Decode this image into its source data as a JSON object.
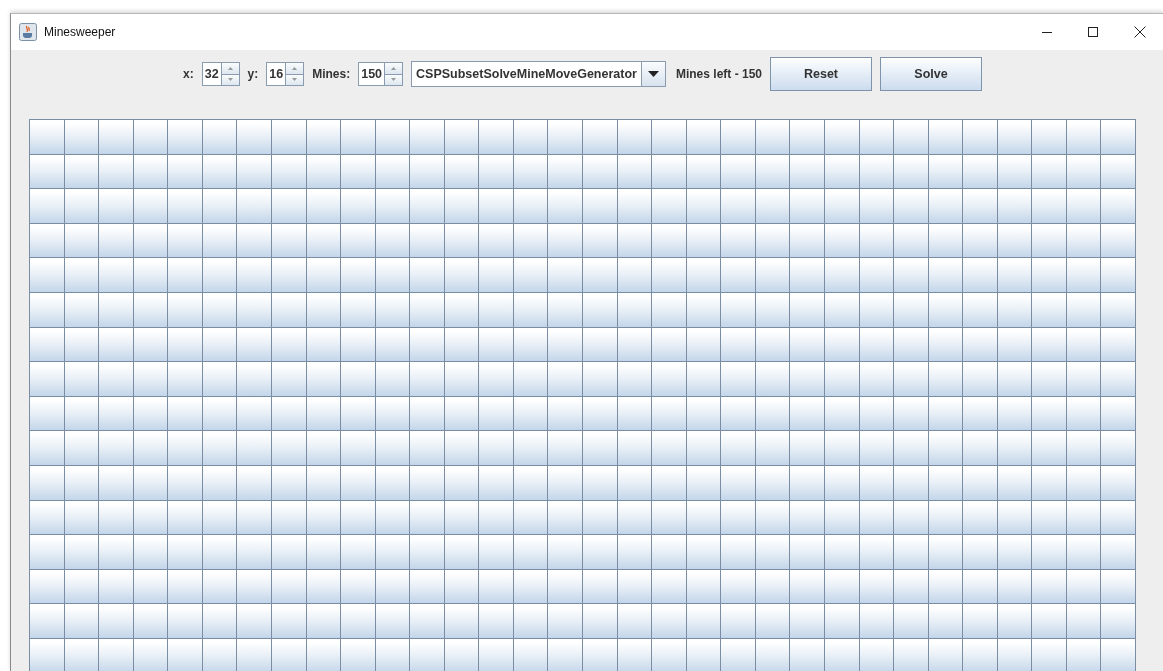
{
  "window": {
    "title": "Minesweeper"
  },
  "toolbar": {
    "fields": [
      {
        "label": "x:",
        "value": "32"
      },
      {
        "label": "y:",
        "value": "16"
      },
      {
        "label": "Mines:",
        "value": "150"
      }
    ],
    "generator": {
      "value": "CSPSubsetSolveMineMoveGenerator"
    },
    "status": "Mines left - 150",
    "buttons": [
      "Reset",
      "Solve"
    ]
  },
  "board": {
    "rows": [
      {
        "cells": [
          {
            "revealed": false
          },
          {
            "revealed": false
          },
          {
            "revealed": false
          },
          {
            "revealed": false
          },
          {
            "revealed": false
          },
          {
            "revealed": false
          },
          {
            "revealed": false
          },
          {
            "revealed": false
          },
          {
            "revealed": false
          },
          {
            "revealed": false
          },
          {
            "revealed": false
          },
          {
            "revealed": false
          },
          {
            "revealed": false
          },
          {
            "revealed": false
          },
          {
            "revealed": false
          },
          {
            "revealed": false
          },
          {
            "revealed": false
          },
          {
            "revealed": false
          },
          {
            "revealed": false
          },
          {
            "revealed": false
          },
          {
            "revealed": false
          },
          {
            "revealed": false
          },
          {
            "revealed": false
          },
          {
            "revealed": false
          },
          {
            "revealed": false
          },
          {
            "revealed": false
          },
          {
            "revealed": false
          },
          {
            "revealed": false
          },
          {
            "revealed": false
          },
          {
            "revealed": false
          },
          {
            "revealed": false
          },
          {
            "revealed": false
          }
        ]
      },
      {
        "cells": [
          {
            "revealed": false
          },
          {
            "revealed": false
          },
          {
            "revealed": false
          },
          {
            "revealed": false
          },
          {
            "revealed": false
          },
          {
            "revealed": false
          },
          {
            "revealed": false
          },
          {
            "revealed": false
          },
          {
            "revealed": false
          },
          {
            "revealed": false
          },
          {
            "revealed": false
          },
          {
            "revealed": false
          },
          {
            "revealed": false
          },
          {
            "revealed": false
          },
          {
            "revealed": false
          },
          {
            "revealed": false
          },
          {
            "revealed": false
          },
          {
            "revealed": false
          },
          {
            "revealed": false
          },
          {
            "revealed": false
          },
          {
            "revealed": false
          },
          {
            "revealed": false
          },
          {
            "revealed": false
          },
          {
            "revealed": false
          },
          {
            "revealed": false
          },
          {
            "revealed": false
          },
          {
            "revealed": false
          },
          {
            "revealed": false
          },
          {
            "revealed": false
          },
          {
            "revealed": false
          },
          {
            "revealed": false
          },
          {
            "revealed": false
          }
        ]
      },
      {
        "cells": [
          {
            "revealed": false
          },
          {
            "revealed": false
          },
          {
            "revealed": false
          },
          {
            "revealed": false
          },
          {
            "revealed": false
          },
          {
            "revealed": false
          },
          {
            "revealed": false
          },
          {
            "revealed": false
          },
          {
            "revealed": false
          },
          {
            "revealed": false
          },
          {
            "revealed": false
          },
          {
            "revealed": false
          },
          {
            "revealed": false
          },
          {
            "revealed": false
          },
          {
            "revealed": false
          },
          {
            "revealed": false
          },
          {
            "revealed": false
          },
          {
            "revealed": false
          },
          {
            "revealed": false
          },
          {
            "revealed": false
          },
          {
            "revealed": false
          },
          {
            "revealed": false
          },
          {
            "revealed": false
          },
          {
            "revealed": false
          },
          {
            "revealed": false
          },
          {
            "revealed": false
          },
          {
            "revealed": false
          },
          {
            "revealed": false
          },
          {
            "revealed": false
          },
          {
            "revealed": false
          },
          {
            "revealed": false
          },
          {
            "revealed": false
          }
        ]
      },
      {
        "cells": [
          {
            "revealed": false
          },
          {
            "revealed": false
          },
          {
            "revealed": false
          },
          {
            "revealed": false
          },
          {
            "revealed": false
          },
          {
            "revealed": false
          },
          {
            "revealed": false
          },
          {
            "revealed": false
          },
          {
            "revealed": false
          },
          {
            "revealed": false
          },
          {
            "revealed": false
          },
          {
            "revealed": false
          },
          {
            "revealed": false
          },
          {
            "revealed": false
          },
          {
            "revealed": false
          },
          {
            "revealed": false
          },
          {
            "revealed": false
          },
          {
            "revealed": false
          },
          {
            "revealed": false
          },
          {
            "revealed": false
          },
          {
            "revealed": false
          },
          {
            "revealed": false
          },
          {
            "revealed": false
          },
          {
            "revealed": false
          },
          {
            "revealed": false
          },
          {
            "revealed": false
          },
          {
            "revealed": false
          },
          {
            "revealed": false
          },
          {
            "revealed": false
          },
          {
            "revealed": false
          },
          {
            "revealed": false
          },
          {
            "revealed": false
          }
        ]
      },
      {
        "cells": [
          {
            "revealed": false
          },
          {
            "revealed": false
          },
          {
            "revealed": false
          },
          {
            "revealed": false
          },
          {
            "revealed": false
          },
          {
            "revealed": false
          },
          {
            "revealed": false
          },
          {
            "revealed": false
          },
          {
            "revealed": false
          },
          {
            "revealed": false
          },
          {
            "revealed": false
          },
          {
            "revealed": false
          },
          {
            "revealed": false
          },
          {
            "revealed": false
          },
          {
            "revealed": false
          },
          {
            "revealed": false
          },
          {
            "revealed": false
          },
          {
            "revealed": false
          },
          {
            "revealed": false
          },
          {
            "revealed": false
          },
          {
            "revealed": false
          },
          {
            "revealed": false
          },
          {
            "revealed": false
          },
          {
            "revealed": false
          },
          {
            "revealed": false
          },
          {
            "revealed": false
          },
          {
            "revealed": false
          },
          {
            "revealed": false
          },
          {
            "revealed": false
          },
          {
            "revealed": false
          },
          {
            "revealed": false
          },
          {
            "revealed": false
          }
        ]
      },
      {
        "cells": [
          {
            "revealed": false
          },
          {
            "revealed": false
          },
          {
            "revealed": false
          },
          {
            "revealed": false
          },
          {
            "revealed": false
          },
          {
            "revealed": false
          },
          {
            "revealed": false
          },
          {
            "revealed": false
          },
          {
            "revealed": false
          },
          {
            "revealed": false
          },
          {
            "revealed": false
          },
          {
            "revealed": false
          },
          {
            "revealed": false
          },
          {
            "revealed": false
          },
          {
            "revealed": false
          },
          {
            "revealed": false
          },
          {
            "revealed": false
          },
          {
            "revealed": false
          },
          {
            "revealed": false
          },
          {
            "revealed": false
          },
          {
            "revealed": false
          },
          {
            "revealed": false
          },
          {
            "revealed": false
          },
          {
            "revealed": false
          },
          {
            "revealed": false
          },
          {
            "revealed": false
          },
          {
            "revealed": false
          },
          {
            "revealed": false
          },
          {
            "revealed": false
          },
          {
            "revealed": false
          },
          {
            "revealed": false
          },
          {
            "revealed": false
          }
        ]
      },
      {
        "cells": [
          {
            "revealed": false
          },
          {
            "revealed": false
          },
          {
            "revealed": false
          },
          {
            "revealed": false
          },
          {
            "revealed": false
          },
          {
            "revealed": false
          },
          {
            "revealed": false
          },
          {
            "revealed": false
          },
          {
            "revealed": false
          },
          {
            "revealed": false
          },
          {
            "revealed": false
          },
          {
            "revealed": false
          },
          {
            "revealed": false
          },
          {
            "revealed": false
          },
          {
            "revealed": false
          },
          {
            "revealed": false
          },
          {
            "revealed": false
          },
          {
            "revealed": false
          },
          {
            "revealed": false
          },
          {
            "revealed": false
          },
          {
            "revealed": false
          },
          {
            "revealed": false
          },
          {
            "revealed": false
          },
          {
            "revealed": false
          },
          {
            "revealed": false
          },
          {
            "revealed": false
          },
          {
            "revealed": false
          },
          {
            "revealed": false
          },
          {
            "revealed": false
          },
          {
            "revealed": false
          },
          {
            "revealed": false
          },
          {
            "revealed": false
          }
        ]
      },
      {
        "cells": [
          {
            "revealed": false
          },
          {
            "revealed": false
          },
          {
            "revealed": false
          },
          {
            "revealed": false
          },
          {
            "revealed": false
          },
          {
            "revealed": false
          },
          {
            "revealed": false
          },
          {
            "revealed": false
          },
          {
            "revealed": false
          },
          {
            "revealed": false
          },
          {
            "revealed": false
          },
          {
            "revealed": false
          },
          {
            "revealed": false
          },
          {
            "revealed": false
          },
          {
            "revealed": false
          },
          {
            "revealed": false
          },
          {
            "revealed": false
          },
          {
            "revealed": false
          },
          {
            "revealed": false
          },
          {
            "revealed": false
          },
          {
            "revealed": false
          },
          {
            "revealed": false
          },
          {
            "revealed": false
          },
          {
            "revealed": false
          },
          {
            "revealed": false
          },
          {
            "revealed": false
          },
          {
            "revealed": false
          },
          {
            "revealed": false
          },
          {
            "revealed": false
          },
          {
            "revealed": false
          },
          {
            "revealed": false
          },
          {
            "revealed": false
          }
        ]
      },
      {
        "cells": [
          {
            "revealed": false
          },
          {
            "revealed": false
          },
          {
            "revealed": false
          },
          {
            "revealed": false
          },
          {
            "revealed": false
          },
          {
            "revealed": false
          },
          {
            "revealed": false
          },
          {
            "revealed": false
          },
          {
            "revealed": false
          },
          {
            "revealed": false
          },
          {
            "revealed": false
          },
          {
            "revealed": false
          },
          {
            "revealed": false
          },
          {
            "revealed": false
          },
          {
            "revealed": false
          },
          {
            "revealed": false
          },
          {
            "revealed": false
          },
          {
            "revealed": false
          },
          {
            "revealed": false
          },
          {
            "revealed": false
          },
          {
            "revealed": false
          },
          {
            "revealed": false
          },
          {
            "revealed": false
          },
          {
            "revealed": false
          },
          {
            "revealed": false
          },
          {
            "revealed": false
          },
          {
            "revealed": false
          },
          {
            "revealed": false
          },
          {
            "revealed": false
          },
          {
            "revealed": false
          },
          {
            "revealed": false
          },
          {
            "revealed": false
          }
        ]
      },
      {
        "cells": [
          {
            "revealed": false
          },
          {
            "revealed": false
          },
          {
            "revealed": false
          },
          {
            "revealed": false
          },
          {
            "revealed": false
          },
          {
            "revealed": false
          },
          {
            "revealed": false
          },
          {
            "revealed": false
          },
          {
            "revealed": false
          },
          {
            "revealed": false
          },
          {
            "revealed": false
          },
          {
            "revealed": false
          },
          {
            "revealed": false
          },
          {
            "revealed": false
          },
          {
            "revealed": false
          },
          {
            "revealed": false
          },
          {
            "revealed": false
          },
          {
            "revealed": false
          },
          {
            "revealed": false
          },
          {
            "revealed": false
          },
          {
            "revealed": false
          },
          {
            "revealed": false
          },
          {
            "revealed": false
          },
          {
            "revealed": false
          },
          {
            "revealed": false
          },
          {
            "revealed": false
          },
          {
            "revealed": false
          },
          {
            "revealed": false
          },
          {
            "revealed": false
          },
          {
            "revealed": false
          },
          {
            "revealed": false
          },
          {
            "revealed": false
          }
        ]
      },
      {
        "cells": [
          {
            "revealed": false
          },
          {
            "revealed": false
          },
          {
            "revealed": false
          },
          {
            "revealed": false
          },
          {
            "revealed": false
          },
          {
            "revealed": false
          },
          {
            "revealed": false
          },
          {
            "revealed": false
          },
          {
            "revealed": false
          },
          {
            "revealed": false
          },
          {
            "revealed": false
          },
          {
            "revealed": false
          },
          {
            "revealed": false
          },
          {
            "revealed": false
          },
          {
            "revealed": false
          },
          {
            "revealed": false
          },
          {
            "revealed": false
          },
          {
            "revealed": false
          },
          {
            "revealed": false
          },
          {
            "revealed": false
          },
          {
            "revealed": false
          },
          {
            "revealed": false
          },
          {
            "revealed": false
          },
          {
            "revealed": false
          },
          {
            "revealed": false
          },
          {
            "revealed": false
          },
          {
            "revealed": false
          },
          {
            "revealed": false
          },
          {
            "revealed": false
          },
          {
            "revealed": false
          },
          {
            "revealed": false
          },
          {
            "revealed": false
          }
        ]
      },
      {
        "cells": [
          {
            "revealed": false
          },
          {
            "revealed": false
          },
          {
            "revealed": false
          },
          {
            "revealed": false
          },
          {
            "revealed": false
          },
          {
            "revealed": false
          },
          {
            "revealed": false
          },
          {
            "revealed": false
          },
          {
            "revealed": false
          },
          {
            "revealed": false
          },
          {
            "revealed": false
          },
          {
            "revealed": false
          },
          {
            "revealed": false
          },
          {
            "revealed": false
          },
          {
            "revealed": false
          },
          {
            "revealed": false
          },
          {
            "revealed": false
          },
          {
            "revealed": false
          },
          {
            "revealed": false
          },
          {
            "revealed": false
          },
          {
            "revealed": false
          },
          {
            "revealed": false
          },
          {
            "revealed": false
          },
          {
            "revealed": false
          },
          {
            "revealed": false
          },
          {
            "revealed": false
          },
          {
            "revealed": false
          },
          {
            "revealed": false
          },
          {
            "revealed": false
          },
          {
            "revealed": false
          },
          {
            "revealed": false
          },
          {
            "revealed": false
          }
        ]
      },
      {
        "cells": [
          {
            "revealed": false
          },
          {
            "revealed": false
          },
          {
            "revealed": false
          },
          {
            "revealed": false
          },
          {
            "revealed": false
          },
          {
            "revealed": false
          },
          {
            "revealed": false
          },
          {
            "revealed": false
          },
          {
            "revealed": false
          },
          {
            "revealed": false
          },
          {
            "revealed": false
          },
          {
            "revealed": false
          },
          {
            "revealed": false
          },
          {
            "revealed": false
          },
          {
            "revealed": false
          },
          {
            "revealed": false
          },
          {
            "revealed": false
          },
          {
            "revealed": false
          },
          {
            "revealed": false
          },
          {
            "revealed": false
          },
          {
            "revealed": false
          },
          {
            "revealed": false
          },
          {
            "revealed": false
          },
          {
            "revealed": false
          },
          {
            "revealed": false
          },
          {
            "revealed": false
          },
          {
            "revealed": false
          },
          {
            "revealed": false
          },
          {
            "revealed": false
          },
          {
            "revealed": false
          },
          {
            "revealed": false
          },
          {
            "revealed": false
          }
        ]
      },
      {
        "cells": [
          {
            "revealed": false
          },
          {
            "revealed": false
          },
          {
            "revealed": false
          },
          {
            "revealed": false
          },
          {
            "revealed": false
          },
          {
            "revealed": false
          },
          {
            "revealed": false
          },
          {
            "revealed": false
          },
          {
            "revealed": false
          },
          {
            "revealed": false
          },
          {
            "revealed": false
          },
          {
            "revealed": false
          },
          {
            "revealed": false
          },
          {
            "revealed": false
          },
          {
            "revealed": false
          },
          {
            "revealed": false
          },
          {
            "revealed": false
          },
          {
            "revealed": false
          },
          {
            "revealed": false
          },
          {
            "revealed": false
          },
          {
            "revealed": false
          },
          {
            "revealed": false
          },
          {
            "revealed": false
          },
          {
            "revealed": false
          },
          {
            "revealed": false
          },
          {
            "revealed": false
          },
          {
            "revealed": false
          },
          {
            "revealed": false
          },
          {
            "revealed": false
          },
          {
            "revealed": false
          },
          {
            "revealed": false
          },
          {
            "revealed": false
          }
        ]
      },
      {
        "cells": [
          {
            "revealed": false
          },
          {
            "revealed": false
          },
          {
            "revealed": false
          },
          {
            "revealed": false
          },
          {
            "revealed": false
          },
          {
            "revealed": false
          },
          {
            "revealed": false
          },
          {
            "revealed": false
          },
          {
            "revealed": false
          },
          {
            "revealed": false
          },
          {
            "revealed": false
          },
          {
            "revealed": false
          },
          {
            "revealed": false
          },
          {
            "revealed": false
          },
          {
            "revealed": false
          },
          {
            "revealed": false
          },
          {
            "revealed": false
          },
          {
            "revealed": false
          },
          {
            "revealed": false
          },
          {
            "revealed": false
          },
          {
            "revealed": false
          },
          {
            "revealed": false
          },
          {
            "revealed": false
          },
          {
            "revealed": false
          },
          {
            "revealed": false
          },
          {
            "revealed": false
          },
          {
            "revealed": false
          },
          {
            "revealed": false
          },
          {
            "revealed": false
          },
          {
            "revealed": false
          },
          {
            "revealed": false
          },
          {
            "revealed": false
          }
        ]
      },
      {
        "cells": [
          {
            "revealed": false
          },
          {
            "revealed": false
          },
          {
            "revealed": false
          },
          {
            "revealed": false
          },
          {
            "revealed": false
          },
          {
            "revealed": false
          },
          {
            "revealed": false
          },
          {
            "revealed": false
          },
          {
            "revealed": false
          },
          {
            "revealed": false
          },
          {
            "revealed": false
          },
          {
            "revealed": false
          },
          {
            "revealed": false
          },
          {
            "revealed": false
          },
          {
            "revealed": false
          },
          {
            "revealed": false
          },
          {
            "revealed": false
          },
          {
            "revealed": false
          },
          {
            "revealed": false
          },
          {
            "revealed": false
          },
          {
            "revealed": false
          },
          {
            "revealed": false
          },
          {
            "revealed": false
          },
          {
            "revealed": false
          },
          {
            "revealed": false
          },
          {
            "revealed": false
          },
          {
            "revealed": false
          },
          {
            "revealed": false
          },
          {
            "revealed": false
          },
          {
            "revealed": false
          },
          {
            "revealed": false
          },
          {
            "revealed": false
          }
        ]
      }
    ]
  }
}
